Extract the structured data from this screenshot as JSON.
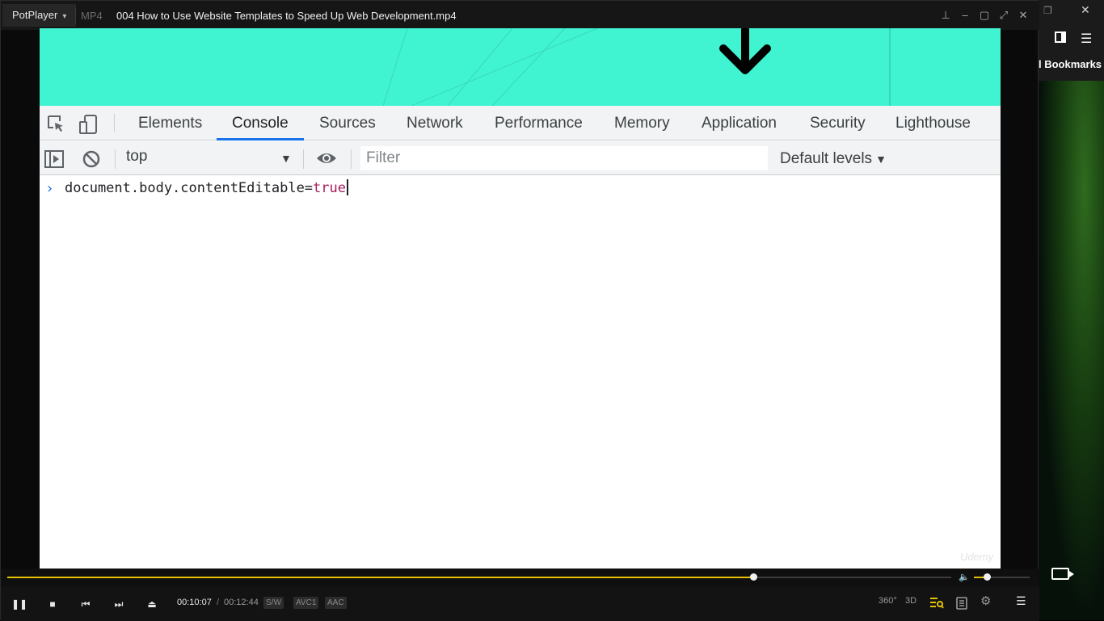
{
  "window": {
    "app_menu": "PotPlayer",
    "format": "MP4",
    "title": "004 How to Use Website Templates to Speed Up Web Development.mp4"
  },
  "background": {
    "bookmarks_label": "l Bookmarks"
  },
  "devtools": {
    "tabs": [
      {
        "label": "Elements"
      },
      {
        "label": "Console"
      },
      {
        "label": "Sources"
      },
      {
        "label": "Network"
      },
      {
        "label": "Performance"
      },
      {
        "label": "Memory"
      },
      {
        "label": "Application"
      },
      {
        "label": "Security"
      },
      {
        "label": "Lighthouse"
      }
    ],
    "active_tab": "Console",
    "accent_color": "#1a73e8",
    "console": {
      "context": "top",
      "filter_placeholder": "Filter",
      "levels": "Default levels",
      "command_prefix": "document.body.contentEditable=",
      "command_value": "true"
    }
  },
  "video": {
    "hero_color": "#40f4d2",
    "watermark": "Udemy"
  },
  "player": {
    "time_current": "00:10:07",
    "time_separator": "/",
    "time_total": "00:12:44",
    "codecs": [
      "S/W",
      "AVC1",
      "AAC"
    ],
    "seek_progress": 0.79,
    "volume_level": 0.23,
    "accent_color": "#e3c100",
    "right_buttons": [
      "360°",
      "3D",
      "playlist-icon",
      "chapters-icon",
      "settings-icon",
      "menu-icon"
    ]
  }
}
